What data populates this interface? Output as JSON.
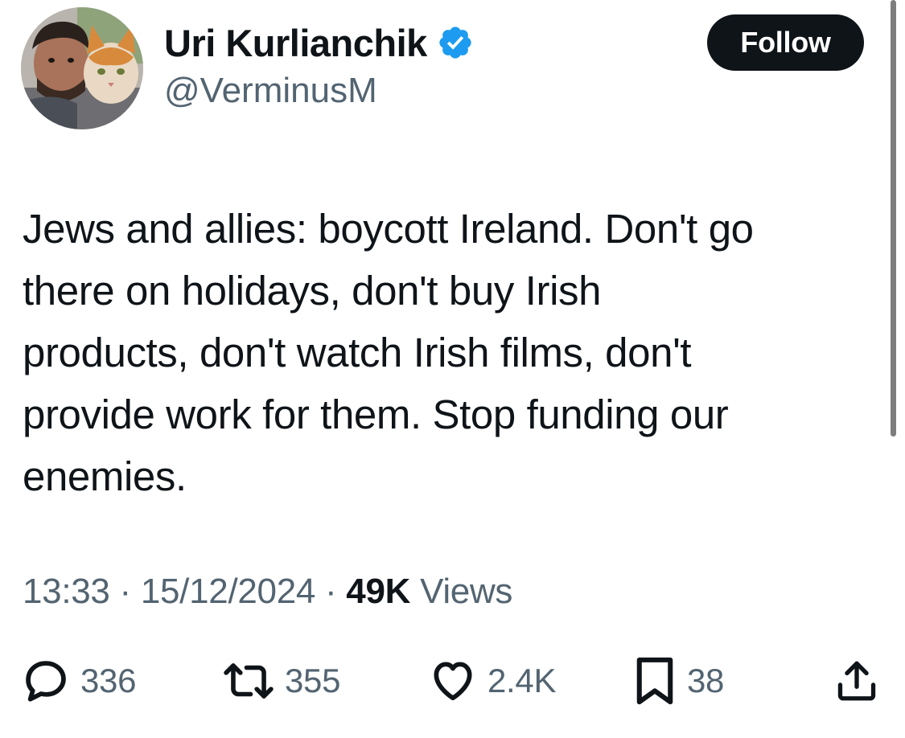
{
  "author": {
    "display_name": "Uri Kurlianchik",
    "handle": "@VerminusM",
    "verified": true,
    "avatar_icon": "profile-photo-man-with-cat"
  },
  "follow_button": {
    "label": "Follow"
  },
  "tweet": {
    "lines": [
      "Jews and allies: boycott Ireland. Don't go",
      "there on holidays, don't buy Irish",
      "products, don't watch Irish films, don't",
      "provide work for them. Stop funding our",
      "enemies."
    ],
    "time": "13:33",
    "separator": "·",
    "date": "15/12/2024",
    "views_count": "49K",
    "views_label": "Views"
  },
  "actions": {
    "replies": "336",
    "reposts": "355",
    "likes": "2.4K",
    "bookmarks": "38"
  },
  "colors": {
    "text_primary": "#0f1419",
    "text_secondary": "#536471",
    "verified_blue": "#1d9bf0",
    "follow_bg": "#0f1419"
  }
}
